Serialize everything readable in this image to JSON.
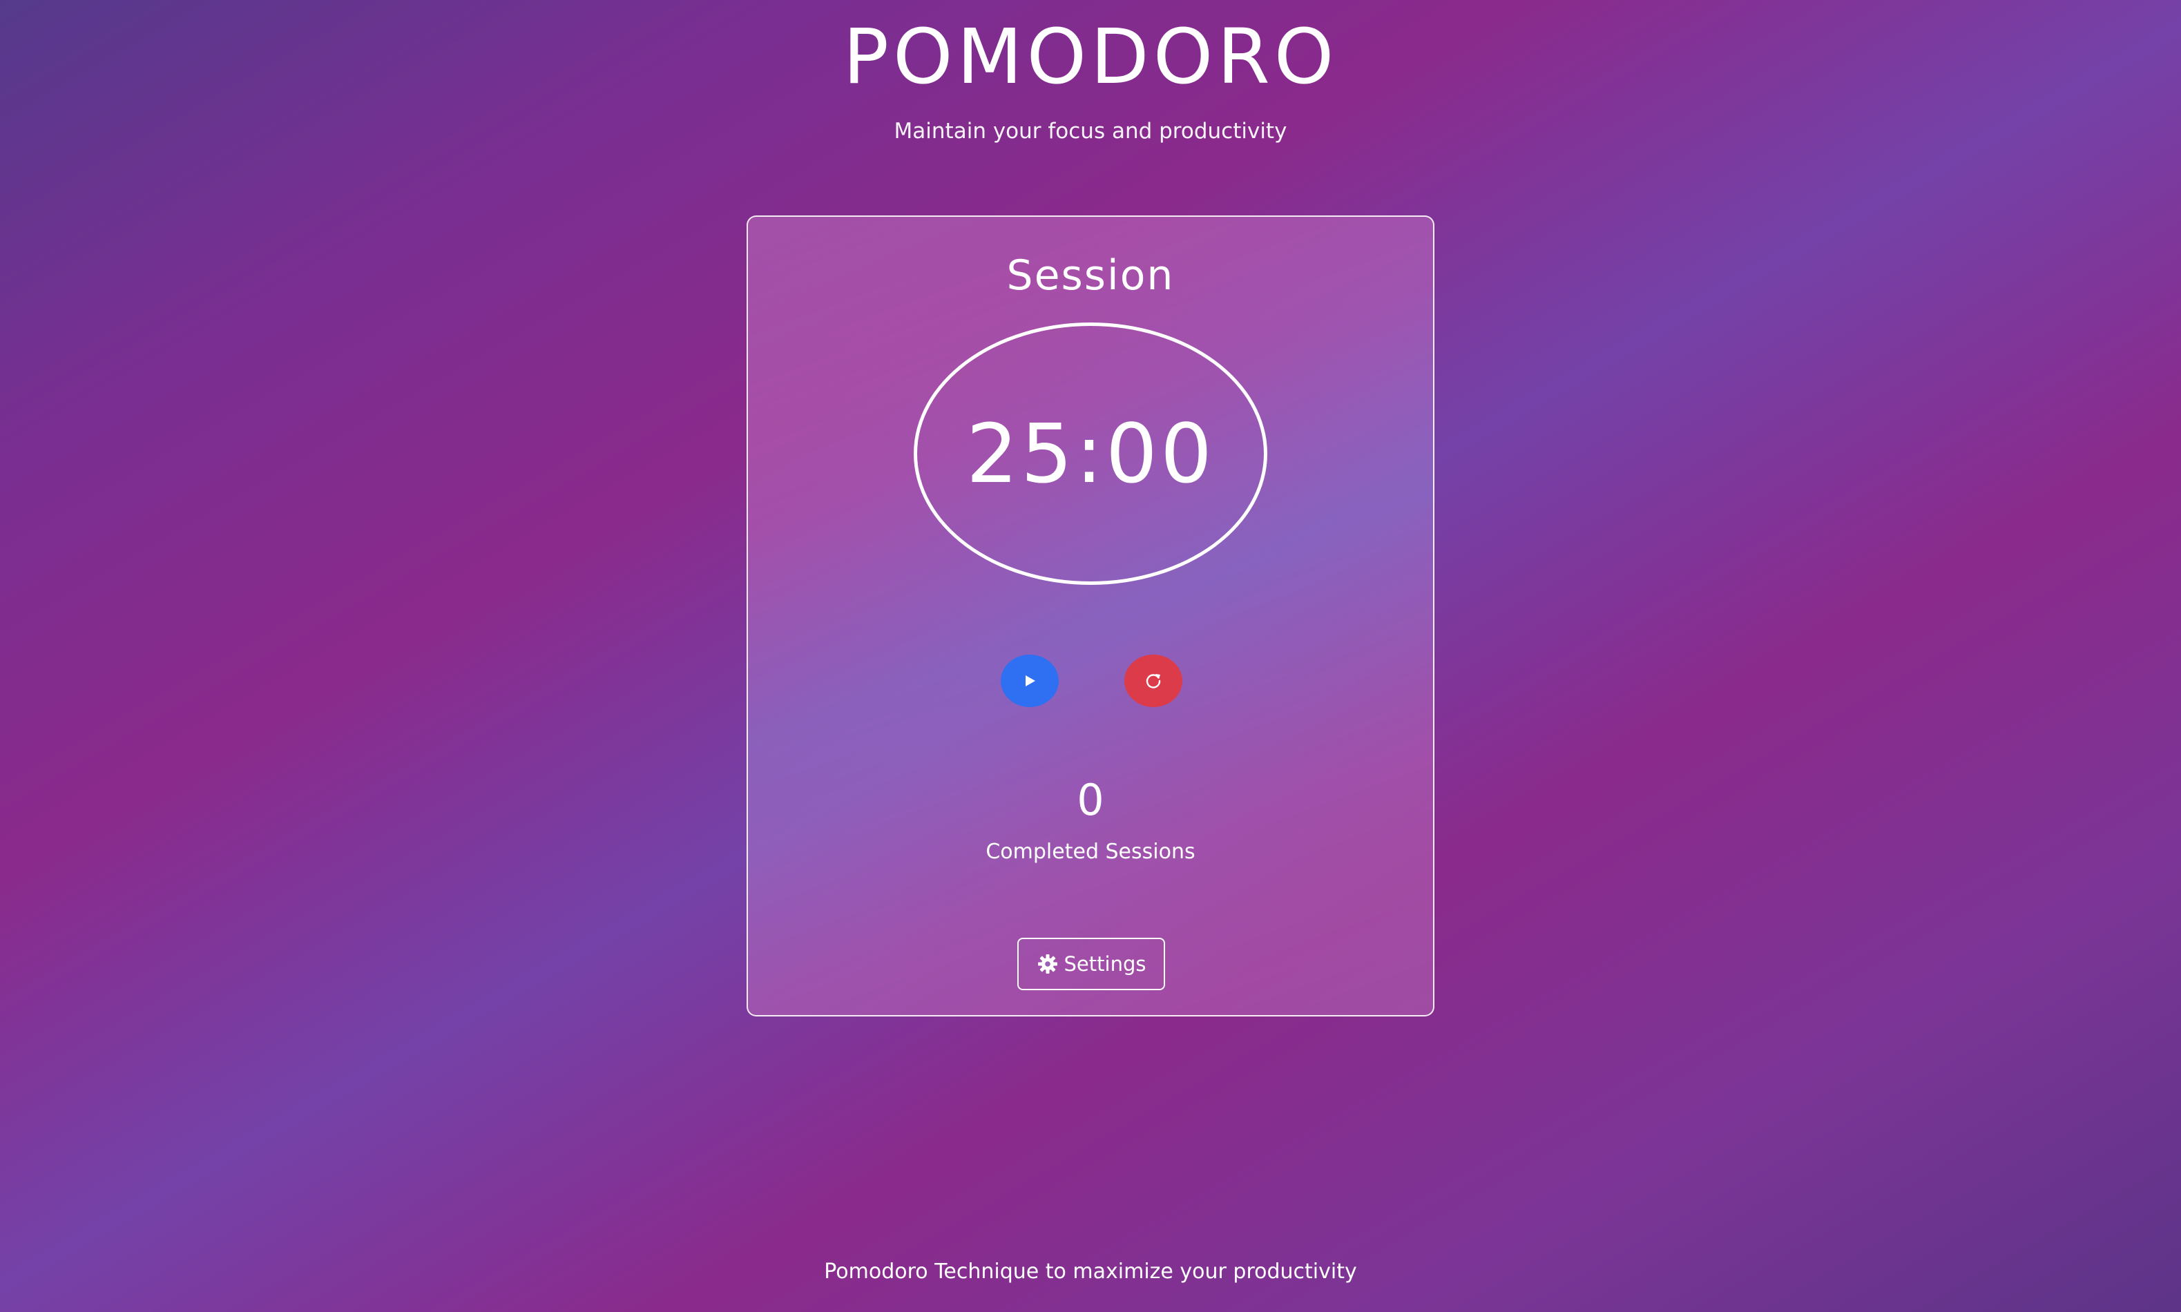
{
  "header": {
    "title": "POMODORO",
    "subtitle": "Maintain your focus and productivity"
  },
  "timer_card": {
    "session_label": "Session",
    "time_display": "25:00",
    "start_icon": "play-icon",
    "reset_icon": "reset-icon",
    "completed_count": "0",
    "completed_label": "Completed Sessions",
    "settings_label": "Settings",
    "settings_icon": "gear-icon"
  },
  "footer": {
    "text": "Pomodoro Technique to maximize your productivity"
  },
  "colors": {
    "start_button": "#2f6ff2",
    "reset_button": "#dc3b4a",
    "text": "#ffffff"
  }
}
